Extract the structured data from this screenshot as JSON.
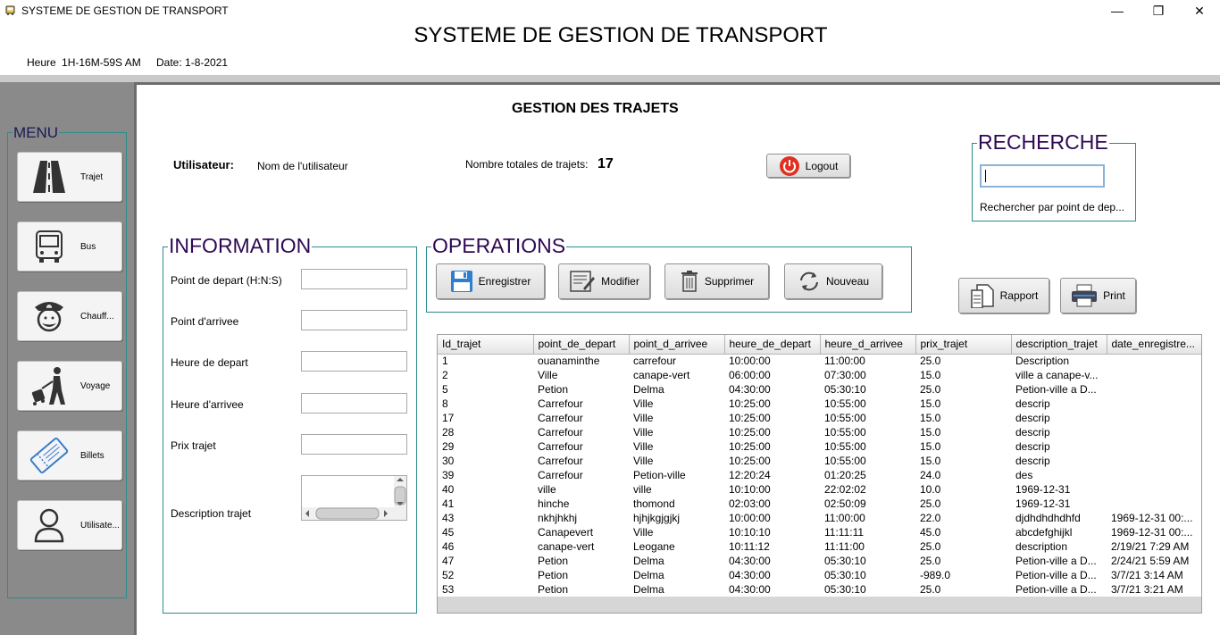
{
  "window": {
    "title": "SYSTEME DE GESTION DE TRANSPORT",
    "minimize": "—",
    "maximize": "❐",
    "close": "✕"
  },
  "header": {
    "title": "SYSTEME DE GESTION DE TRANSPORT",
    "time_label": "Heure",
    "time_value": "1H-16M-59S AM",
    "date_label": "Date:",
    "date_value": "1-8-2021"
  },
  "menu": {
    "legend": "MENU",
    "items": [
      {
        "label": "Trajet",
        "icon": "road-icon"
      },
      {
        "label": "Bus",
        "icon": "bus-icon"
      },
      {
        "label": "Chauff...",
        "icon": "driver-icon"
      },
      {
        "label": "Voyage",
        "icon": "traveler-icon"
      },
      {
        "label": "Billets",
        "icon": "ticket-icon"
      },
      {
        "label": "Utilisate...",
        "icon": "user-icon"
      }
    ]
  },
  "page": {
    "title": "GESTION DES TRAJETS",
    "user_label": "Utilisateur:",
    "user_value": "Nom de l'utilisateur",
    "count_label": "Nombre totales de trajets:",
    "count_value": "17",
    "logout_label": "Logout"
  },
  "search": {
    "legend": "RECHERCHE",
    "value": "",
    "hint": "Rechercher par point de dep..."
  },
  "information": {
    "legend": "INFORMATION",
    "fields": [
      {
        "label": "Point de depart (H:N:S)",
        "value": ""
      },
      {
        "label": "Point d'arrivee",
        "value": ""
      },
      {
        "label": "Heure de depart",
        "value": ""
      },
      {
        "label": "Heure d'arrivee",
        "value": ""
      },
      {
        "label": "Prix trajet",
        "value": ""
      }
    ],
    "description_label": "Description trajet"
  },
  "operations": {
    "legend": "OPERATIONS",
    "save": "Enregistrer",
    "edit": "Modifier",
    "delete": "Supprimer",
    "new": "Nouveau"
  },
  "report": {
    "rapport": "Rapport",
    "print": "Print"
  },
  "table": {
    "columns": [
      "Id_trajet",
      "point_de_depart",
      "point_d_arrivee",
      "heure_de_depart",
      "heure_d_arrivee",
      "prix_trajet",
      "description_trajet",
      "date_enregistre..."
    ],
    "rows": [
      [
        "1",
        "ouanaminthe",
        "carrefour",
        "10:00:00",
        "11:00:00",
        "25.0",
        "Description",
        ""
      ],
      [
        "2",
        "Ville",
        "canape-vert",
        "06:00:00",
        "07:30:00",
        "15.0",
        "ville a canape-v...",
        ""
      ],
      [
        "5",
        "Petion",
        "Delma",
        "04:30:00",
        "05:30:10",
        "25.0",
        "Petion-ville a D...",
        ""
      ],
      [
        "8",
        "Carrefour",
        "Ville",
        "10:25:00",
        "10:55:00",
        "15.0",
        "descrip",
        ""
      ],
      [
        "17",
        "Carrefour",
        "Ville",
        "10:25:00",
        "10:55:00",
        "15.0",
        "descrip",
        ""
      ],
      [
        "28",
        "Carrefour",
        "Ville",
        "10:25:00",
        "10:55:00",
        "15.0",
        "descrip",
        ""
      ],
      [
        "29",
        "Carrefour",
        "Ville",
        "10:25:00",
        "10:55:00",
        "15.0",
        "descrip",
        ""
      ],
      [
        "30",
        "Carrefour",
        "Ville",
        "10:25:00",
        "10:55:00",
        "15.0",
        "descrip",
        ""
      ],
      [
        "39",
        "Carrefour",
        "Petion-ville",
        "12:20:24",
        "01:20:25",
        "24.0",
        "des",
        ""
      ],
      [
        "40",
        "ville",
        "ville",
        "10:10:00",
        "22:02:02",
        "10.0",
        "1969-12-31",
        ""
      ],
      [
        "41",
        "hinche",
        "thomond",
        "02:03:00",
        "02:50:09",
        "25.0",
        "1969-12-31",
        ""
      ],
      [
        "43",
        "nkhjhkhj",
        "hjhjkgjgjkj",
        "10:00:00",
        "11:00:00",
        "22.0",
        "djdhdhdhdhfd",
        "1969-12-31 00:..."
      ],
      [
        "45",
        "Canapevert",
        "Ville",
        "10:10:10",
        "11:11:11",
        "45.0",
        "abcdefghijkl",
        "1969-12-31 00:..."
      ],
      [
        "46",
        "canape-vert",
        "Leogane",
        "10:11:12",
        "11:11:00",
        "25.0",
        "description",
        "2/19/21 7:29 AM"
      ],
      [
        "47",
        "Petion",
        "Delma",
        "04:30:00",
        "05:30:10",
        "25.0",
        "Petion-ville a D...",
        "2/24/21 5:59 AM"
      ],
      [
        "52",
        "Petion",
        "Delma",
        "04:30:00",
        "05:30:10",
        "-989.0",
        "Petion-ville a D...",
        "3/7/21 3:14 AM"
      ],
      [
        "53",
        "Petion",
        "Delma",
        "04:30:00",
        "05:30:10",
        "25.0",
        "Petion-ville a D...",
        "3/7/21 3:21 AM"
      ]
    ]
  },
  "colors": {
    "legend_text": "#2e0854",
    "fieldset_border": "#2a8c8c",
    "logout_red": "#e03020",
    "save_blue": "#2f7fd0",
    "left_panel": "#8a8a8a"
  }
}
